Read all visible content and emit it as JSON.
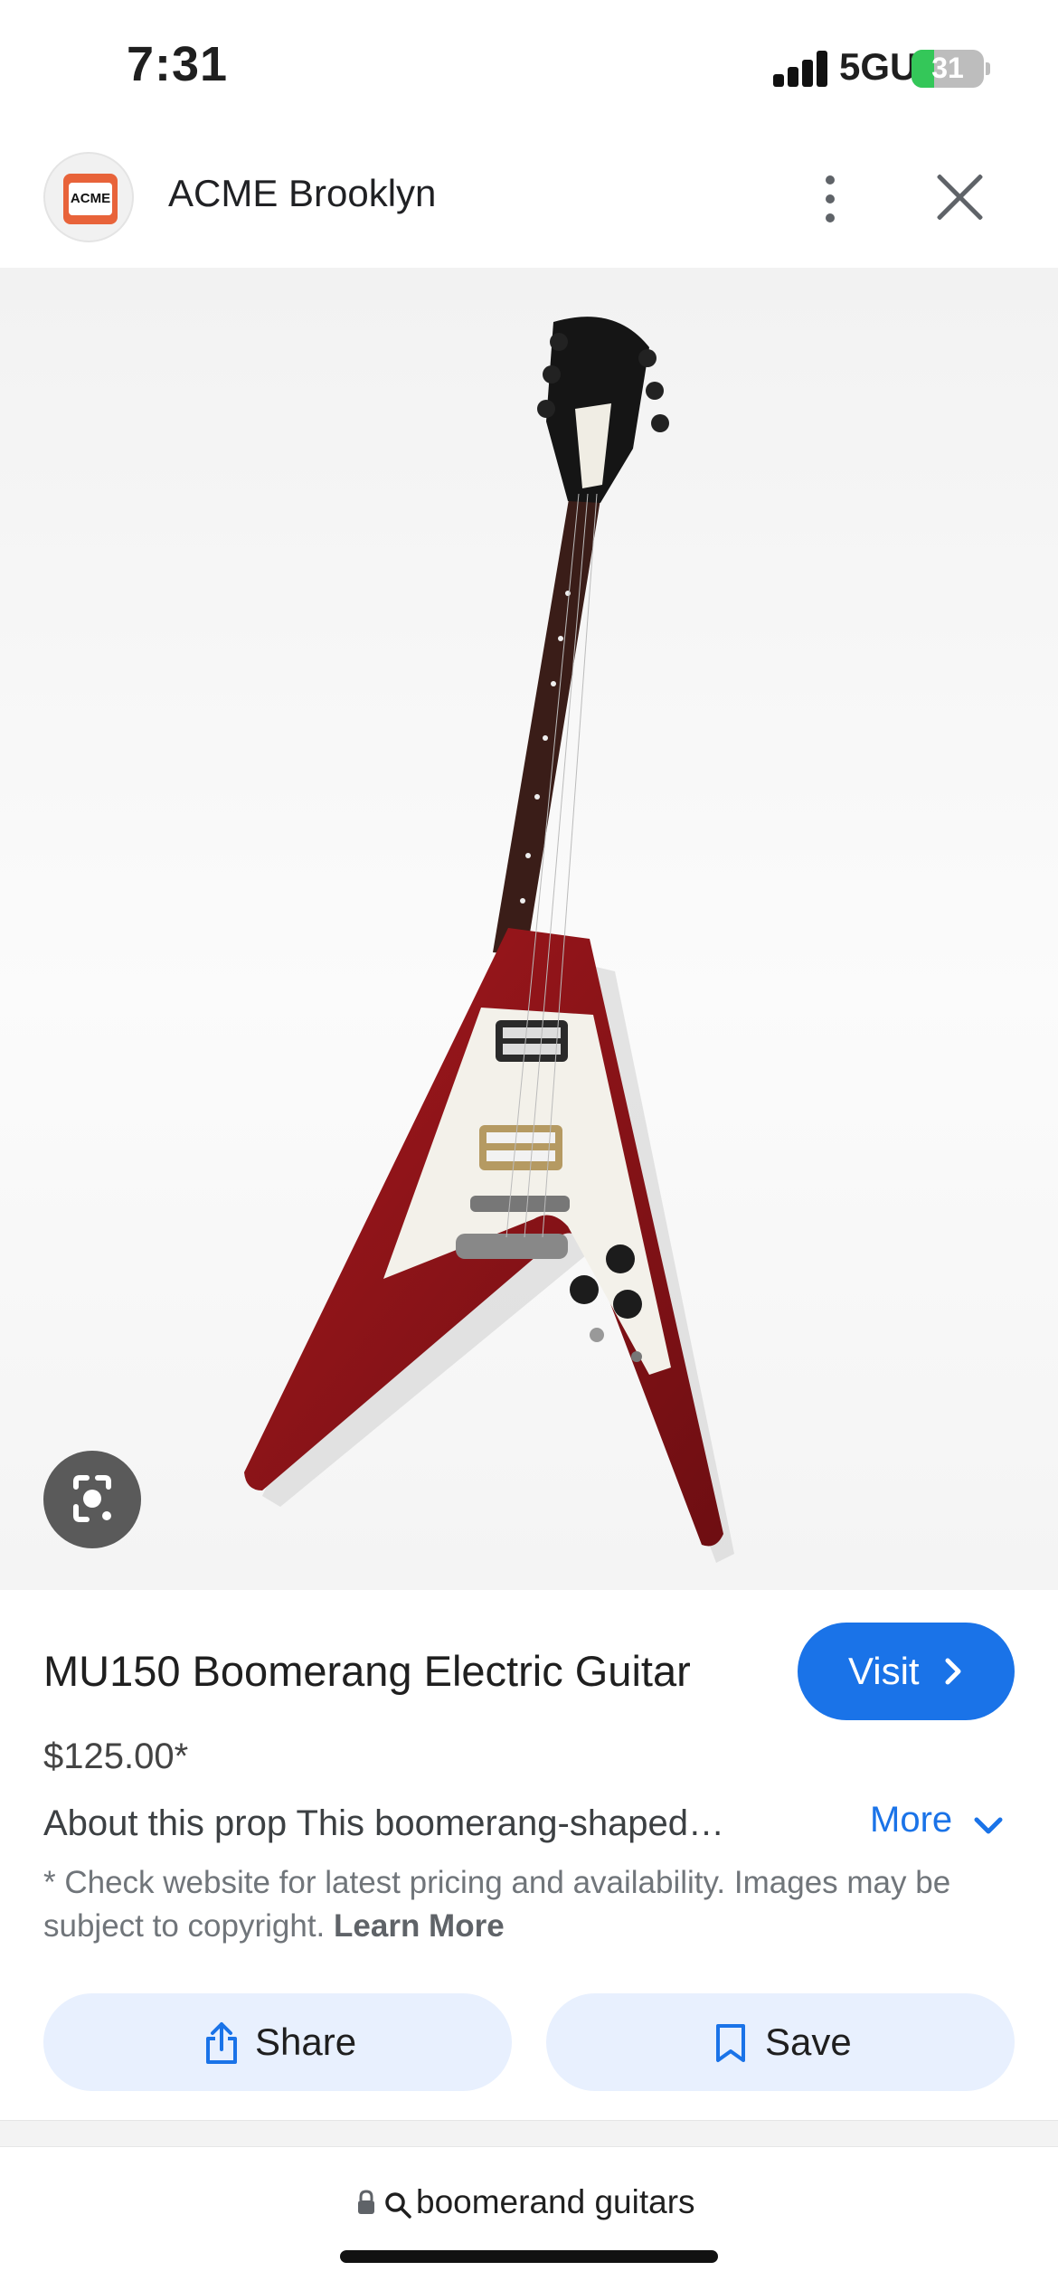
{
  "status_bar": {
    "time": "7:31",
    "network": "5GUC",
    "battery": "31",
    "battery_level": 0.31
  },
  "header": {
    "logo_text": "ACME",
    "site_name": "ACME Brooklyn",
    "menu_icon": "more-vert-icon",
    "close_icon": "close-icon"
  },
  "image": {
    "subject": "guitar-image",
    "lens_icon": "lens-icon"
  },
  "product": {
    "title": "MU150 Boomerang Electric Guitar",
    "visit_label": "Visit",
    "price": "$125.00*",
    "about": "About this prop This boomerang-shaped…",
    "more_label": "More",
    "disclaimer": "* Check website for latest pricing and availability. Images may be subject to copyright.",
    "learn_more": "Learn More"
  },
  "actions": {
    "share_label": "Share",
    "save_label": "Save"
  },
  "url_bar": {
    "text": "boomerand guitars"
  },
  "colors": {
    "accent": "#1a73e8",
    "pill_bg": "#e8f0fe",
    "guitar_body": "#8e1418",
    "pickguard": "#f3f1ea",
    "logo": "#e8633a"
  }
}
